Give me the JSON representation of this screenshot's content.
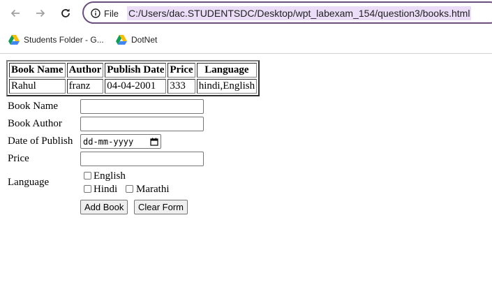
{
  "browser": {
    "site_info_label": "File",
    "url": "C:/Users/dac.STUDENTSDC/Desktop/wpt_labexam_154/question3/books.html",
    "bookmarks": [
      {
        "label": "Students Folder - G...",
        "icon": "google-drive-icon"
      },
      {
        "label": "DotNet",
        "icon": "google-drive-icon"
      }
    ]
  },
  "table": {
    "headers": [
      "Book Name",
      "Author",
      "Publish Date",
      "Price",
      "Language"
    ],
    "rows": [
      [
        "Rahul",
        "franz",
        "04-04-2001",
        "333",
        "hindi,English"
      ]
    ]
  },
  "form": {
    "book_name_label": "Book Name",
    "book_author_label": "Book Author",
    "date_label": "Date of Publish",
    "date_placeholder": "dd-mm-yyyy",
    "price_label": "Price",
    "language_label": "Language",
    "languages": [
      "English",
      "Hindi",
      "Marathi"
    ],
    "add_button": "Add Book",
    "clear_button": "Clear Form"
  }
}
